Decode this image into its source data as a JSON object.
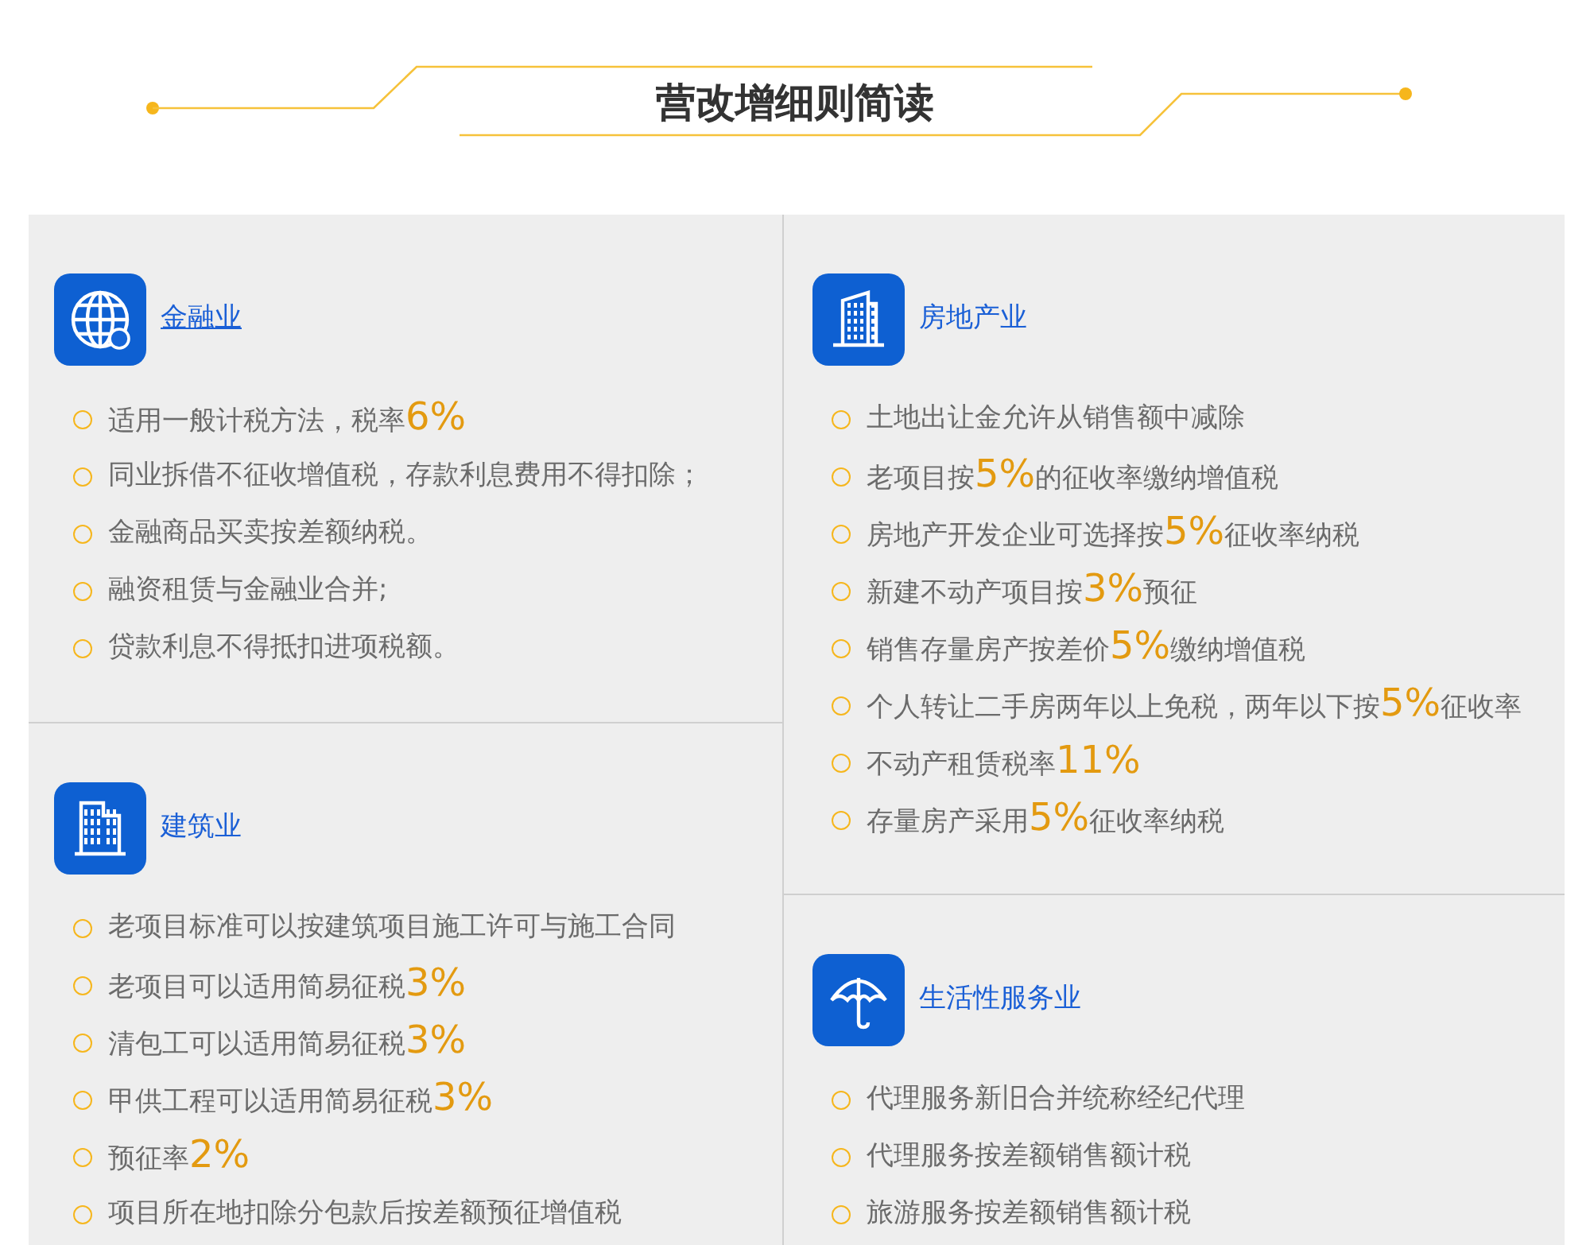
{
  "title": "营改增细则简读",
  "columns": [
    {
      "sections": [
        {
          "kind": "globe",
          "heading": "金融业",
          "underlined": true,
          "items": [
            [
              {
                "kind": "text",
                "text": "适用一般计税方法，税率"
              },
              {
                "kind": "rate",
                "text": "6%"
              }
            ],
            [
              {
                "kind": "text",
                "text": "同业拆借不征收增值税，存款利息费用不得扣除；"
              }
            ],
            [
              {
                "kind": "text",
                "text": "金融商品买卖按差额纳税。"
              }
            ],
            [
              {
                "kind": "text",
                "text": "融资租赁与金融业合并;"
              }
            ],
            [
              {
                "kind": "text",
                "text": "贷款利息不得抵扣进项税额。"
              }
            ]
          ]
        },
        {
          "kind": "building",
          "heading": "建筑业",
          "underlined": false,
          "items": [
            [
              {
                "kind": "text",
                "text": "老项目标准可以按建筑项目施工许可与施工合同"
              }
            ],
            [
              {
                "kind": "text",
                "text": "老项目可以适用简易征税"
              },
              {
                "kind": "rate",
                "text": "3%"
              }
            ],
            [
              {
                "kind": "text",
                "text": "清包工可以适用简易征税"
              },
              {
                "kind": "rate",
                "text": "3%"
              }
            ],
            [
              {
                "kind": "text",
                "text": "甲供工程可以适用简易征税"
              },
              {
                "kind": "rate",
                "text": "3%"
              }
            ],
            [
              {
                "kind": "text",
                "text": "预征率"
              },
              {
                "kind": "rate",
                "text": "2%"
              }
            ],
            [
              {
                "kind": "text",
                "text": "项目所在地扣除分包款后按差额预征增值税"
              }
            ]
          ]
        }
      ]
    },
    {
      "sections": [
        {
          "kind": "tower",
          "heading": "房地产业",
          "underlined": false,
          "items": [
            [
              {
                "kind": "text",
                "text": "土地出让金允许从销售额中减除"
              }
            ],
            [
              {
                "kind": "text",
                "text": "老项目按"
              },
              {
                "kind": "rate",
                "text": "5%"
              },
              {
                "kind": "text",
                "text": "的征收率缴纳增值税"
              }
            ],
            [
              {
                "kind": "text",
                "text": "房地产开发企业可选择按"
              },
              {
                "kind": "rate",
                "text": "5%"
              },
              {
                "kind": "text",
                "text": "征收率纳税"
              }
            ],
            [
              {
                "kind": "text",
                "text": "新建不动产项目按"
              },
              {
                "kind": "rate",
                "text": "3%"
              },
              {
                "kind": "text",
                "text": "预征"
              }
            ],
            [
              {
                "kind": "text",
                "text": "销售存量房产按差价"
              },
              {
                "kind": "rate",
                "text": "5%"
              },
              {
                "kind": "text",
                "text": "缴纳增值税"
              }
            ],
            [
              {
                "kind": "text",
                "text": "个人转让二手房两年以上免税，两年以下按"
              },
              {
                "kind": "rate",
                "text": "5%"
              },
              {
                "kind": "text",
                "text": "征收率"
              }
            ],
            [
              {
                "kind": "text",
                "text": "不动产租赁税率"
              },
              {
                "kind": "rate",
                "text": "11%"
              }
            ],
            [
              {
                "kind": "text",
                "text": "存量房产采用"
              },
              {
                "kind": "rate",
                "text": "5%"
              },
              {
                "kind": "text",
                "text": "征收率纳税"
              }
            ]
          ]
        },
        {
          "kind": "umbrella",
          "heading": "生活性服务业",
          "underlined": false,
          "items": [
            [
              {
                "kind": "text",
                "text": "代理服务新旧合并统称经纪代理"
              }
            ],
            [
              {
                "kind": "text",
                "text": "代理服务按差额销售额计税"
              }
            ],
            [
              {
                "kind": "text",
                "text": "旅游服务按差额销售额计税"
              }
            ]
          ]
        }
      ]
    }
  ]
}
